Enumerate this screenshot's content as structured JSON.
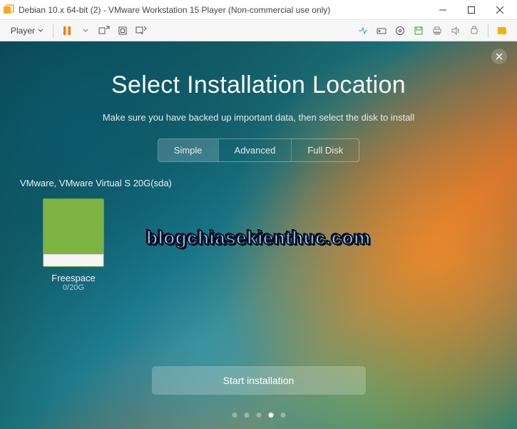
{
  "window": {
    "title": "Debian 10.x 64-bit (2) - VMware Workstation 15 Player (Non-commercial use only)"
  },
  "toolbar": {
    "player_label": "Player"
  },
  "installer": {
    "heading": "Select Installation Location",
    "subtitle": "Make sure you have backed up important data, then select the disk to install",
    "tabs": {
      "simple": "Simple",
      "advanced": "Advanced",
      "full_disk": "Full Disk",
      "active_index": 0
    },
    "disk": {
      "summary": "VMware, VMware Virtual S 20G(sda)",
      "name": "Freespace",
      "capacity": "0/20G"
    },
    "start_button": "Start installation",
    "progress_dots": {
      "count": 5,
      "active_index": 3
    }
  },
  "watermark": "blogchiasekienthuc.com"
}
